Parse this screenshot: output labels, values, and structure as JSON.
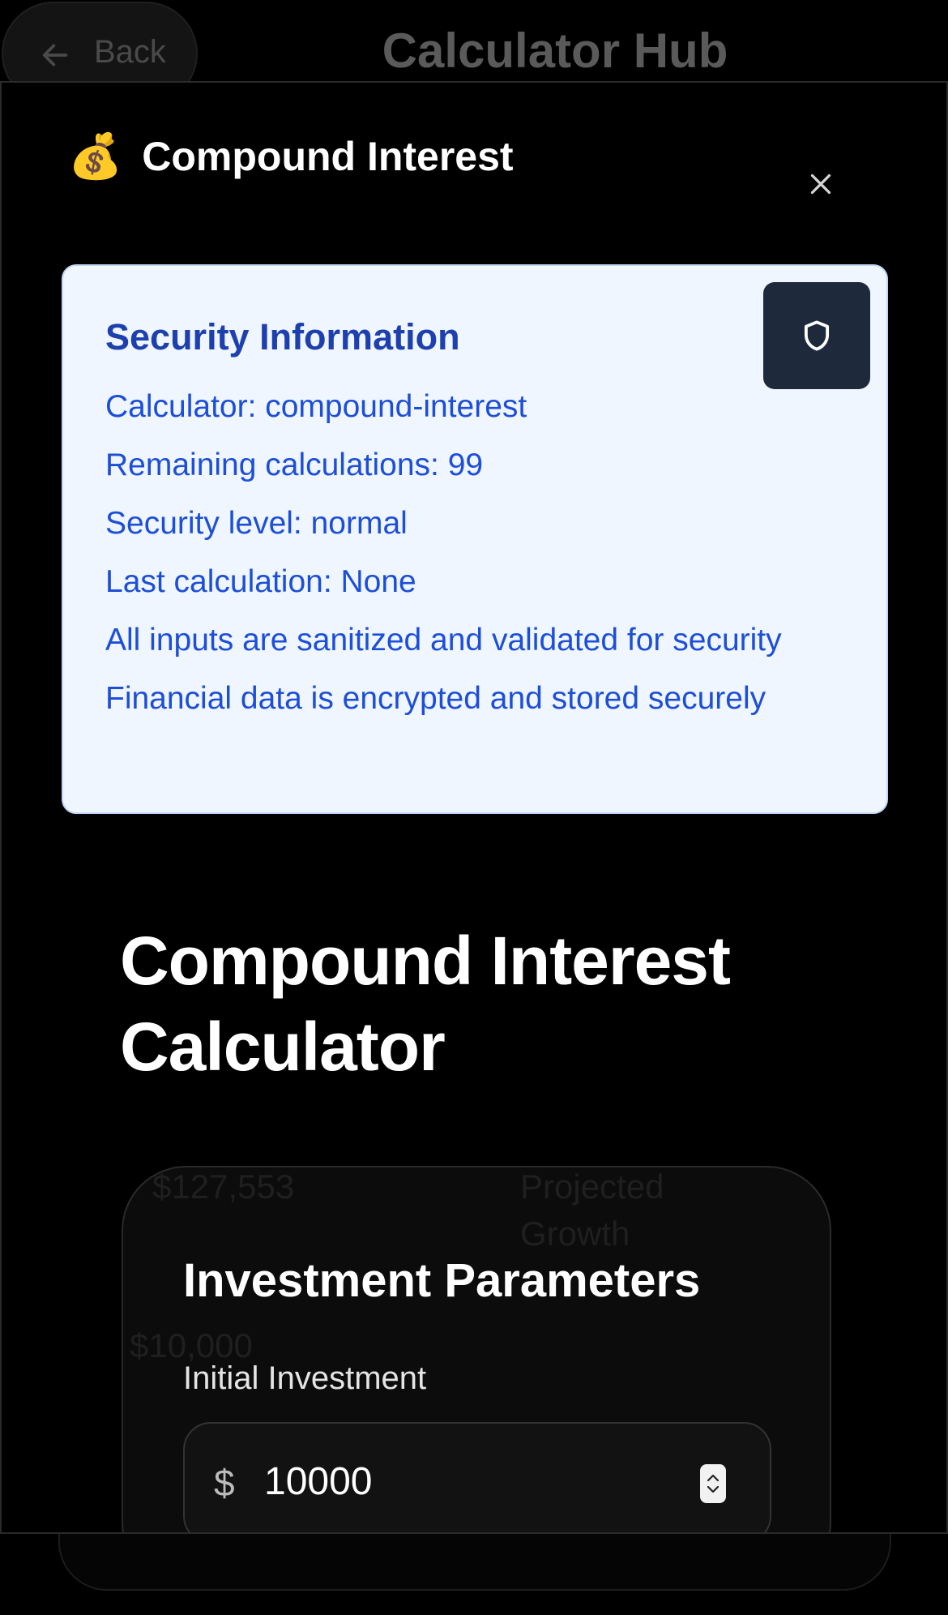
{
  "background": {
    "back_label": "Back",
    "title": "Calculator Hub",
    "ghost_stats": [
      "$127,553",
      "Projected",
      "Growth",
      "$10,000"
    ]
  },
  "modal": {
    "emoji": "💰",
    "title": "Compound Interest",
    "close_icon": "close-icon"
  },
  "security": {
    "title": "Security Information",
    "shield_icon": "shield-icon",
    "lines": [
      "Calculator: compound-interest",
      "Remaining calculations: 99",
      "Security level: normal",
      "Last calculation: None",
      "All inputs are sanitized and validated for security",
      "Financial data is encrypted and stored securely"
    ]
  },
  "calculator": {
    "title": "Compound Interest Calculator",
    "section_title": "Investment Parameters",
    "initial_investment_label": "Initial Investment",
    "currency_symbol": "$",
    "initial_investment_value": "10000"
  },
  "colors": {
    "security_bg": "#eff6ff",
    "security_title": "#1e40af",
    "security_text": "#1d4ed8",
    "shield_button": "#1e293b"
  }
}
